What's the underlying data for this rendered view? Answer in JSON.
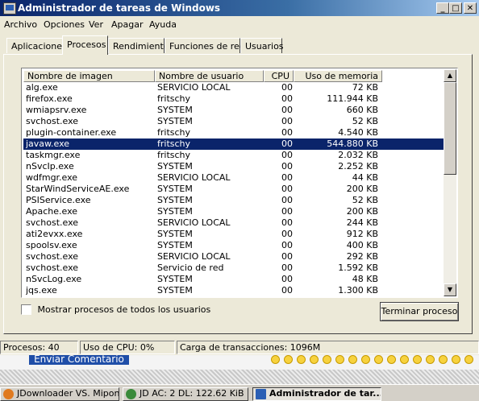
{
  "window": {
    "title": "Administrador de tareas de Windows",
    "minimize_label": "_",
    "maximize_label": "□",
    "close_label": "✕"
  },
  "menu": [
    "Archivo",
    "Opciones",
    "Ver",
    "Apagar",
    "Ayuda"
  ],
  "tabs": [
    {
      "label": "Aplicaciones",
      "active": false
    },
    {
      "label": "Procesos",
      "active": true
    },
    {
      "label": "Rendimiento",
      "active": false
    },
    {
      "label": "Funciones de red",
      "active": false
    },
    {
      "label": "Usuarios",
      "active": false
    }
  ],
  "columns": {
    "image": "Nombre de imagen",
    "user": "Nombre de usuario",
    "cpu": "CPU",
    "mem": "Uso de memoria"
  },
  "processes": [
    {
      "image": "alg.exe",
      "user": "SERVICIO LOCAL",
      "cpu": "00",
      "mem": "72 KB"
    },
    {
      "image": "firefox.exe",
      "user": "fritschy",
      "cpu": "00",
      "mem": "111.944 KB"
    },
    {
      "image": "wmiapsrv.exe",
      "user": "SYSTEM",
      "cpu": "00",
      "mem": "660 KB"
    },
    {
      "image": "svchost.exe",
      "user": "SYSTEM",
      "cpu": "00",
      "mem": "52 KB"
    },
    {
      "image": "plugin-container.exe",
      "user": "fritschy",
      "cpu": "00",
      "mem": "4.540 KB"
    },
    {
      "image": "javaw.exe",
      "user": "fritschy",
      "cpu": "00",
      "mem": "544.880 KB",
      "selected": true
    },
    {
      "image": "taskmgr.exe",
      "user": "fritschy",
      "cpu": "00",
      "mem": "2.032 KB"
    },
    {
      "image": "nSvcIp.exe",
      "user": "SYSTEM",
      "cpu": "00",
      "mem": "2.252 KB"
    },
    {
      "image": "wdfmgr.exe",
      "user": "SERVICIO LOCAL",
      "cpu": "00",
      "mem": "44 KB"
    },
    {
      "image": "StarWindServiceAE.exe",
      "user": "SYSTEM",
      "cpu": "00",
      "mem": "200 KB"
    },
    {
      "image": "PSIService.exe",
      "user": "SYSTEM",
      "cpu": "00",
      "mem": "52 KB"
    },
    {
      "image": "Apache.exe",
      "user": "SYSTEM",
      "cpu": "00",
      "mem": "200 KB"
    },
    {
      "image": "svchost.exe",
      "user": "SERVICIO LOCAL",
      "cpu": "00",
      "mem": "244 KB"
    },
    {
      "image": "ati2evxx.exe",
      "user": "SYSTEM",
      "cpu": "00",
      "mem": "912 KB"
    },
    {
      "image": "spoolsv.exe",
      "user": "SYSTEM",
      "cpu": "00",
      "mem": "400 KB"
    },
    {
      "image": "svchost.exe",
      "user": "SERVICIO LOCAL",
      "cpu": "00",
      "mem": "292 KB"
    },
    {
      "image": "svchost.exe",
      "user": "Servicio de red",
      "cpu": "00",
      "mem": "1.592 KB"
    },
    {
      "image": "nSvcLog.exe",
      "user": "SYSTEM",
      "cpu": "00",
      "mem": "48 KB"
    },
    {
      "image": "jqs.exe",
      "user": "SYSTEM",
      "cpu": "00",
      "mem": "1.300 KB"
    }
  ],
  "scroll": {
    "up": "▲",
    "down": "▼"
  },
  "show_all": {
    "label": "Mostrar procesos de todos los usuarios",
    "checked": false
  },
  "end_process_label": "Terminar proceso",
  "status": {
    "processes": "Procesos: 40",
    "cpu": "Uso de CPU: 0%",
    "commit": "Carga de transacciones: 1096M"
  },
  "behind": {
    "button_label": "Enviar Comentario"
  },
  "taskbar": [
    {
      "label": "JDownloader VS. Mipony...",
      "active": false
    },
    {
      "label": "JD AC: 2 DL: 122.62 KiB",
      "active": false
    },
    {
      "label": "Administrador de tar...",
      "active": true
    }
  ],
  "colors": {
    "titlebar_start": "#0a246a",
    "titlebar_end": "#a6caf0",
    "selection": "#0a246a",
    "face": "#ece9d8"
  }
}
